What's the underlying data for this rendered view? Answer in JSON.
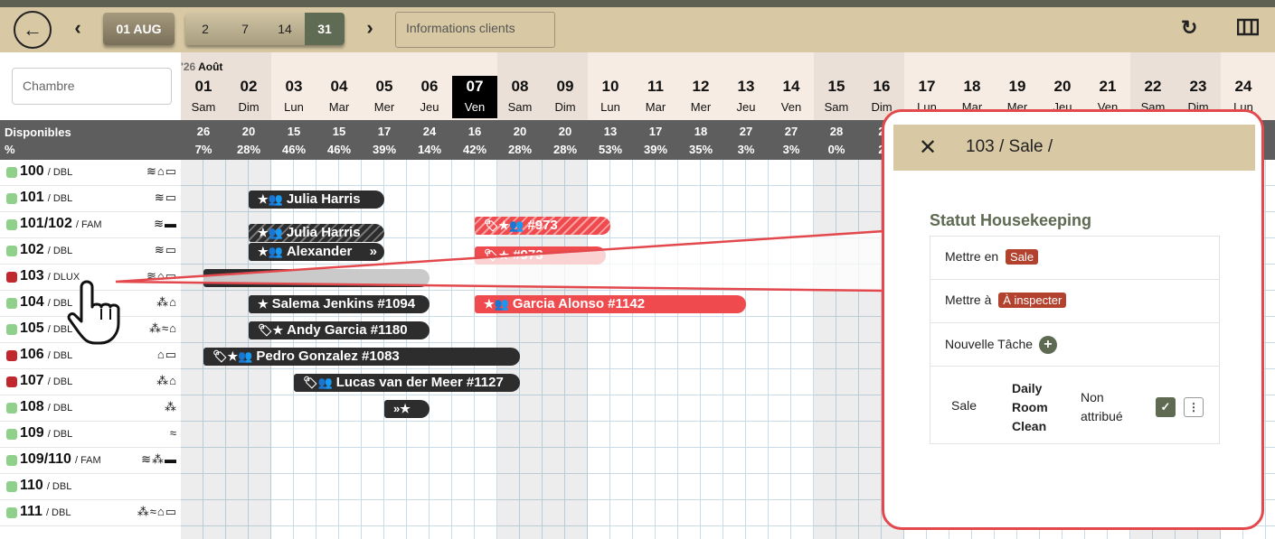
{
  "toolbar": {
    "back_icon": "back-arrow-icon",
    "prev_icon": "chevron-left-icon",
    "date": "01 AUG",
    "ranges": [
      "2",
      "7",
      "14",
      "31"
    ],
    "active_range": "31",
    "next_icon": "chevron-right-icon",
    "clients_placeholder": "Informations clients",
    "refresh_icon": "refresh-icon",
    "columns_icon": "columns-icon"
  },
  "search": {
    "placeholder": "Chambre"
  },
  "calendar": {
    "year": "'26",
    "month": "Août",
    "days": [
      {
        "n": "01",
        "d": "Sam"
      },
      {
        "n": "02",
        "d": "Dim"
      },
      {
        "n": "03",
        "d": "Lun"
      },
      {
        "n": "04",
        "d": "Mar"
      },
      {
        "n": "05",
        "d": "Mer"
      },
      {
        "n": "06",
        "d": "Jeu"
      },
      {
        "n": "07",
        "d": "Ven"
      },
      {
        "n": "08",
        "d": "Sam"
      },
      {
        "n": "09",
        "d": "Dim"
      },
      {
        "n": "10",
        "d": "Lun"
      },
      {
        "n": "11",
        "d": "Mar"
      },
      {
        "n": "12",
        "d": "Mer"
      },
      {
        "n": "13",
        "d": "Jeu"
      },
      {
        "n": "14",
        "d": "Ven"
      },
      {
        "n": "15",
        "d": "Sam"
      },
      {
        "n": "16",
        "d": "Dim"
      },
      {
        "n": "17",
        "d": "Lun"
      },
      {
        "n": "18",
        "d": "Mar"
      },
      {
        "n": "19",
        "d": "Mer"
      },
      {
        "n": "20",
        "d": "Jeu"
      },
      {
        "n": "21",
        "d": "Ven"
      },
      {
        "n": "22",
        "d": "Sam"
      },
      {
        "n": "23",
        "d": "Dim"
      },
      {
        "n": "24",
        "d": "Lun"
      }
    ],
    "today": "07"
  },
  "availability": {
    "label": "Disponibles",
    "pct_label": "%",
    "counts": [
      "26",
      "20",
      "15",
      "15",
      "17",
      "24",
      "16",
      "20",
      "20",
      "13",
      "17",
      "18",
      "27",
      "27",
      "28",
      "2"
    ],
    "percents": [
      "7%",
      "28%",
      "46%",
      "46%",
      "39%",
      "14%",
      "42%",
      "28%",
      "28%",
      "53%",
      "39%",
      "35%",
      "3%",
      "3%",
      "0%",
      "2"
    ]
  },
  "rooms": [
    {
      "num": "100",
      "type": "/ DBL",
      "status": "green",
      "icons": "≋⌂▭"
    },
    {
      "num": "101",
      "type": "/ DBL",
      "status": "green",
      "icons": "≋▭"
    },
    {
      "num": "101/102",
      "type": "/ FAM",
      "status": "green",
      "icons": "≋▬"
    },
    {
      "num": "102",
      "type": "/ DBL",
      "status": "green",
      "icons": "≋▭"
    },
    {
      "num": "103",
      "type": "/ DLUX",
      "status": "red",
      "icons": "≋⌂▭"
    },
    {
      "num": "104",
      "type": "/ DBL",
      "status": "green",
      "icons": "⁂⌂"
    },
    {
      "num": "105",
      "type": "/ DBL",
      "status": "green",
      "icons": "⁂≈⌂"
    },
    {
      "num": "106",
      "type": "/ DBL",
      "status": "red",
      "icons": "⌂▭"
    },
    {
      "num": "107",
      "type": "/ DBL",
      "status": "red",
      "icons": "⁂⌂"
    },
    {
      "num": "108",
      "type": "/ DBL",
      "status": "green",
      "icons": "⁂"
    },
    {
      "num": "109",
      "type": "/ DBL",
      "status": "green",
      "icons": "≈"
    },
    {
      "num": "109/110",
      "type": "/ FAM",
      "status": "green",
      "icons": "≋⁂▬"
    },
    {
      "num": "110",
      "type": "/ DBL",
      "status": "green",
      "icons": ""
    },
    {
      "num": "111",
      "type": "/ DBL",
      "status": "green",
      "icons": "⁂≈⌂▭"
    }
  ],
  "bookings": [
    {
      "name": "Julia Harris",
      "icons": "★👥",
      "style": "dark"
    },
    {
      "name": "Julia Harris",
      "icons": "★👥",
      "style": "hatch-dark"
    },
    {
      "name": "#973",
      "icons": "🏷★👥",
      "style": "hatch-red"
    },
    {
      "name": "Alexander",
      "icons": "★👥",
      "suffix": "»",
      "style": "dark"
    },
    {
      "name": "#973",
      "icons": "🏷★",
      "style": "red"
    },
    {
      "name": "Salema Jenkins #1094",
      "icons": "★",
      "style": "dark"
    },
    {
      "name": "Garcia Alonso #1142",
      "icons": "★👥",
      "style": "red"
    },
    {
      "name": "Andy Garcia #1180",
      "icons": "🏷★",
      "style": "dark"
    },
    {
      "name": "Pedro Gonzalez #1083",
      "icons": "🏷★👥",
      "style": "dark"
    },
    {
      "name": "Lucas van der Meer #1127",
      "icons": "🏷👥",
      "style": "dark"
    },
    {
      "name": "",
      "icons": "»★",
      "style": "dark"
    }
  ],
  "panel": {
    "close_icon": "close-icon",
    "title": "103 / Sale /",
    "section_title": "Statut Housekeeping",
    "set_to_label": "Mettre en",
    "set_to_tag": "Sale",
    "set_at_label": "Mettre à",
    "set_at_tag": "À inspecter",
    "new_task_label": "Nouvelle Tâche",
    "task": {
      "status": "Sale",
      "name": "Daily Room Clean",
      "assignee": "Non attribué",
      "check_icon": "check-icon",
      "more_icon": "more-vertical-icon"
    }
  },
  "colors": {
    "toolbar_bg": "#d8c9a4",
    "accent_olive": "#5e6a52",
    "booking_dark": "#2d2d2d",
    "booking_red": "#ef4b4e",
    "status_green": "#8fd08a",
    "status_red": "#c0282d",
    "callout_red": "#e2484c"
  }
}
